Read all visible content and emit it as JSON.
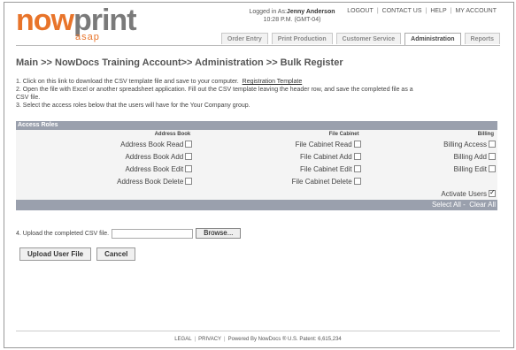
{
  "brand": {
    "name_orange": "now",
    "name_gray": "print",
    "tagline": "asap"
  },
  "user": {
    "logged_in_label": "Logged in As:",
    "name": "Jenny Anderson",
    "time": "10:28 P.M. (GMT-04)"
  },
  "top_links": [
    "LOGOUT",
    "CONTACT US",
    "HELP",
    "MY ACCOUNT"
  ],
  "tabs": [
    "Order Entry",
    "Print Production",
    "Customer Service",
    "Administration",
    "Reports"
  ],
  "active_tab": "Administration",
  "breadcrumb": "Main >> NowDocs Training Account>> Administration >> Bulk Register",
  "instructions": {
    "step1": "1. Click on this link to download the CSV template file and save to your computer.",
    "step1_link": "Registration Template",
    "step2": "2. Open the file with Excel or another spreadsheet application. Fill out the CSV template leaving the header row, and save the completed file as a CSV file.",
    "step3": "3. Select the access roles below that the users will have for the Your Company group."
  },
  "roles": {
    "title": "Access Roles",
    "columns": [
      "Address Book",
      "File Cabinet",
      "Billing"
    ],
    "rows": [
      [
        "Address Book Read",
        "File Cabinet Read",
        "Billing Access"
      ],
      [
        "Address Book Add",
        "File Cabinet Add",
        "Billing Add"
      ],
      [
        "Address Book Edit",
        "File Cabinet Edit",
        "Billing Edit"
      ],
      [
        "Address Book Delete",
        "File Cabinet Delete",
        ""
      ]
    ],
    "activate_label": "Activate Users",
    "activate_checked": true,
    "select_all": "Select All",
    "clear_all": "Clear All"
  },
  "upload": {
    "label": "4. Upload the completed CSV file.",
    "browse": "Browse..."
  },
  "buttons": {
    "upload": "Upload User File",
    "cancel": "Cancel"
  },
  "footer": {
    "legal": "LEGAL",
    "privacy": "PRIVACY",
    "powered": "Powered By NowDocs ® U.S. Patent: 6,615,234"
  }
}
